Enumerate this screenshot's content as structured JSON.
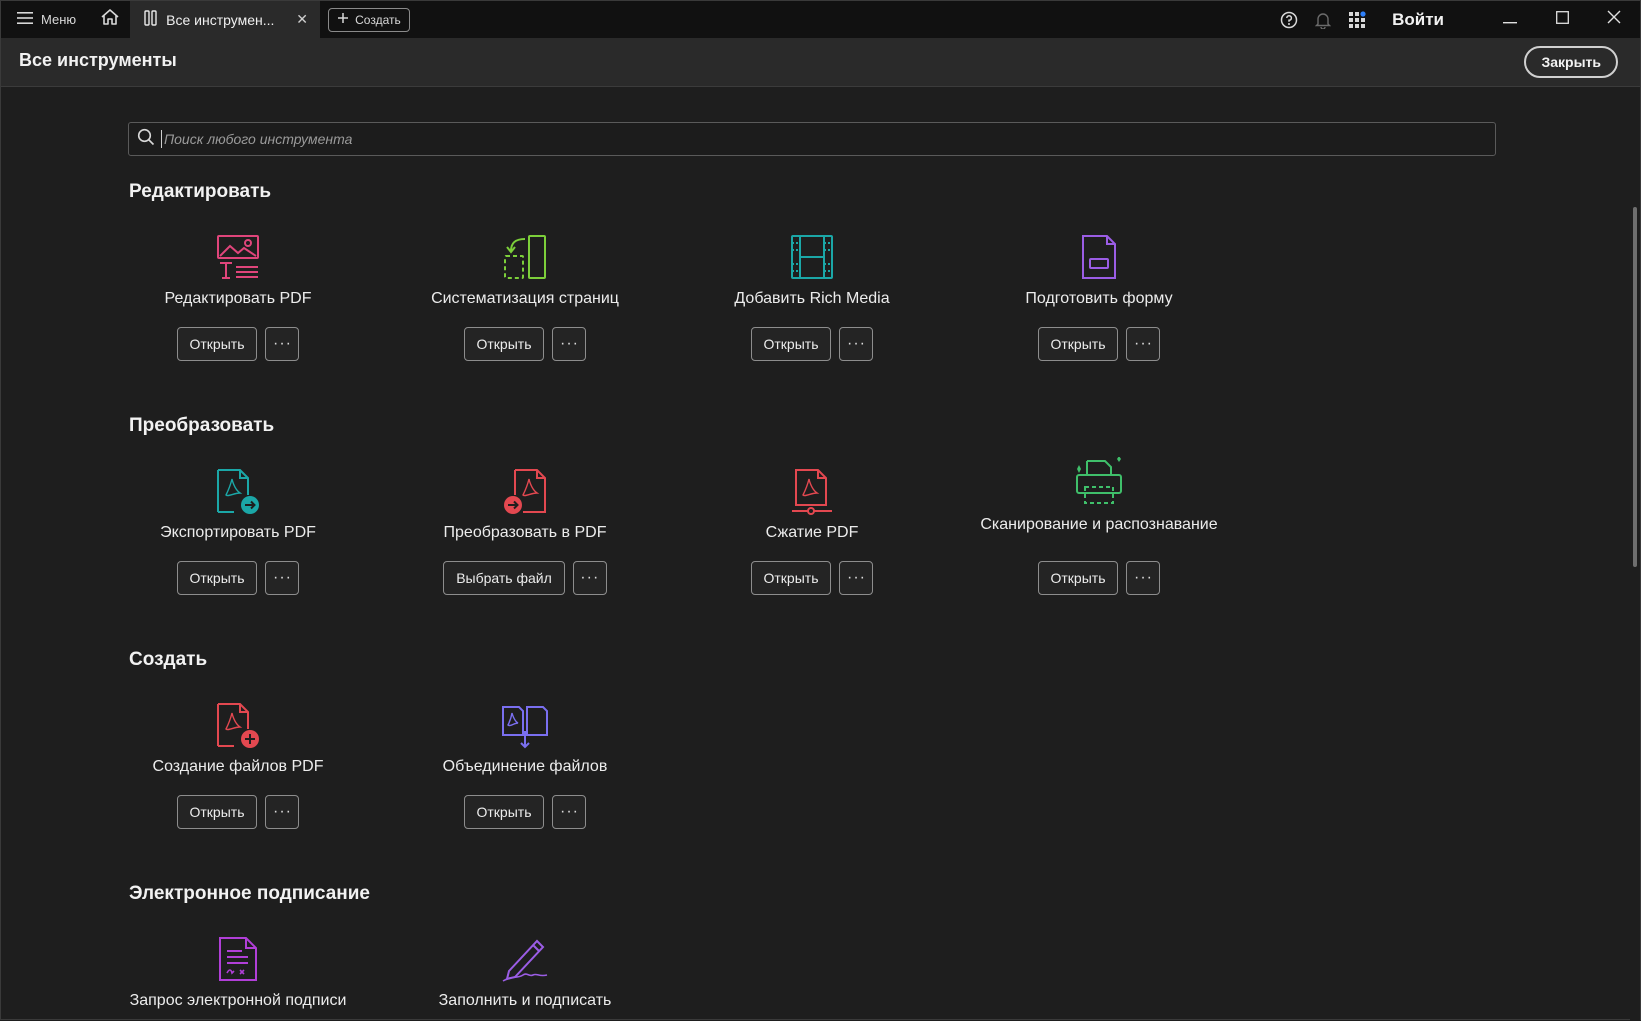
{
  "titlebar": {
    "menu_label": "Меню",
    "tab_label": "Все инструмен...",
    "tab_close": "✕",
    "create_label": "Создать",
    "signin_label": "Войти"
  },
  "header": {
    "title": "Все инструменты",
    "close_label": "Закрыть"
  },
  "search": {
    "placeholder": "Поиск любого инструмента"
  },
  "sections": [
    {
      "title": "Редактировать",
      "tools": [
        {
          "name": "Редактировать PDF",
          "action": "Открыть",
          "icon": "edit-pdf-icon",
          "color": "#e0457b"
        },
        {
          "name": "Систематизация страниц",
          "action": "Открыть",
          "icon": "organize-pages-icon",
          "color": "#7ccf3a"
        },
        {
          "name": "Добавить Rich Media",
          "action": "Открыть",
          "icon": "rich-media-icon",
          "color": "#1ba7a7"
        },
        {
          "name": "Подготовить форму",
          "action": "Открыть",
          "icon": "prepare-form-icon",
          "color": "#9b5de5"
        }
      ]
    },
    {
      "title": "Преобразовать",
      "tools": [
        {
          "name": "Экспортировать PDF",
          "action": "Открыть",
          "icon": "export-pdf-icon",
          "color": "#1ba7a7"
        },
        {
          "name": "Преобразовать в PDF",
          "action": "Выбрать файл",
          "icon": "convert-to-pdf-icon",
          "color": "#e34850"
        },
        {
          "name": "Сжатие PDF",
          "action": "Открыть",
          "icon": "compress-pdf-icon",
          "color": "#e34850"
        },
        {
          "name": "Сканирование и распознавание",
          "action": "Открыть",
          "icon": "scan-ocr-icon",
          "color": "#3fbf6a"
        }
      ]
    },
    {
      "title": "Создать",
      "tools": [
        {
          "name": "Создание файлов PDF",
          "action": "Открыть",
          "icon": "create-pdf-icon",
          "color": "#e34850"
        },
        {
          "name": "Объединение файлов",
          "action": "Открыть",
          "icon": "combine-files-icon",
          "color": "#7a6ff0"
        }
      ]
    },
    {
      "title": "Электронное подписание",
      "tools": [
        {
          "name": "Запрос электронной подписи",
          "icon": "request-esign-icon",
          "color": "#b13fd8"
        },
        {
          "name": "Заполнить и подписать",
          "icon": "fill-sign-icon",
          "color": "#9b5de5"
        }
      ]
    }
  ],
  "more_label": "···"
}
